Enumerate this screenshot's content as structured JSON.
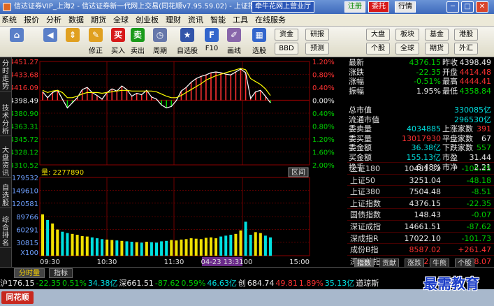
{
  "titlebar": {
    "text": "信达证券VIP_上海2 - 信达证券新一代网上交易(同花顺v7.95.59.02) - 上证指数",
    "promo": "牵牛花网上营业厅",
    "btn_register": "注册",
    "btn_delegate": "委托",
    "btn_market": "行情",
    "win_min": "─",
    "win_max": "□",
    "win_close": "✕"
  },
  "menu": [
    "系统",
    "报价",
    "分析",
    "数据",
    "期货",
    "全球",
    "创业板",
    "理财",
    "资讯",
    "智能",
    "工具",
    "在线服务"
  ],
  "toolbar": {
    "buttons": [
      {
        "label": "",
        "icon": "home-icon",
        "glyph": "⌂"
      },
      {
        "label": "",
        "icon": "back-icon",
        "glyph": "◀"
      },
      {
        "label": "",
        "icon": "updown-arrows-icon",
        "glyph": "⇕"
      },
      {
        "label": "修正",
        "icon": "modify-icon",
        "glyph": "✎"
      },
      {
        "label": "买入",
        "icon": "buy-icon",
        "glyph": "买"
      },
      {
        "label": "卖出",
        "icon": "sell-icon",
        "glyph": "卖"
      },
      {
        "label": "周期",
        "icon": "clock-icon",
        "glyph": "◷"
      },
      {
        "label": "自选股",
        "icon": "favorites-icon",
        "glyph": "★"
      },
      {
        "label": "F10",
        "icon": "f10-icon",
        "glyph": "F"
      },
      {
        "label": "画线",
        "icon": "draw-line-icon",
        "glyph": "✐"
      },
      {
        "label": "选股",
        "icon": "stock-filter-icon",
        "glyph": "▦"
      }
    ],
    "small": [
      {
        "label": "资金"
      },
      {
        "label": "研报"
      },
      {
        "label": "大盘"
      },
      {
        "label": "板块"
      },
      {
        "label": "基金"
      },
      {
        "label": "港股"
      },
      {
        "label": "BBD"
      },
      {
        "label": "预测"
      },
      {
        "label": "个股"
      },
      {
        "label": "全球"
      },
      {
        "label": "期货"
      },
      {
        "label": "外汇"
      }
    ]
  },
  "left_tabs": [
    "分时走势",
    "技术分析",
    "大盘资讯",
    "自选股",
    "综合排名"
  ],
  "chart_data": {
    "type": "line",
    "title": "",
    "price_axis": {
      "ticks": [
        "4451.27",
        "4433.68",
        "4416.09",
        "4398.49",
        "4380.90",
        "4363.31",
        "4345.72",
        "4328.12",
        "4310.52"
      ],
      "pct_ticks": [
        "1.20%",
        "0.80%",
        "0.40%",
        "0.00%",
        "0.40%",
        "0.80%",
        "1.20%",
        "1.60%",
        "2.00%"
      ],
      "ylim": [
        4310.52,
        4451.27
      ],
      "preclose": 4398.49
    },
    "volume_axis": {
      "label": "量: 2277890",
      "ticks": [
        "179532",
        "149610",
        "120581",
        "89766",
        "60291",
        "30815"
      ],
      "multiplier": "X100",
      "ylim": [
        0,
        179532
      ]
    },
    "time_axis": {
      "ticks": [
        "09:30",
        "10:30",
        "11:30",
        "14:00",
        "15:00"
      ],
      "cursor_time": "04-23 13:31"
    },
    "range_label": "区间",
    "series": [
      {
        "name": "",
        "color": "#ffffff",
        "values": [
          4410,
          4402,
          4409,
          4412,
          4400,
          4388,
          4395,
          4402,
          4413,
          4416,
          4409,
          4405,
          4400,
          4409,
          4414,
          4411,
          4418,
          4413,
          4404,
          4408,
          4406,
          4412,
          4403,
          4400,
          4392,
          4388,
          4390,
          4398,
          4411,
          4416,
          4423,
          4428,
          4431,
          4433,
          4436,
          4437,
          4436,
          4434,
          4433,
          4437,
          4441,
          4436,
          4401,
          4410,
          4412,
          4404,
          4395
        ]
      },
      {
        "name": "",
        "color": "#ffff00",
        "values": [
          4412,
          4409,
          4411,
          4412,
          4409,
          4402,
          4402,
          4404,
          4407,
          4409,
          4409,
          4409,
          4408,
          4409,
          4410,
          4411,
          4412,
          4412,
          4411,
          4411,
          4411,
          4411,
          4411,
          4410,
          4407,
          4404,
          4402,
          4402,
          4405,
          4409,
          4413,
          4417,
          4421,
          4426,
          4429,
          4432,
          4434,
          4436,
          4438,
          4440,
          4442,
          4440,
          4428,
          4424,
          4420,
          4414,
          4405
        ]
      }
    ],
    "volumes": [
      95,
      82,
      74,
      60,
      55,
      52,
      50,
      48,
      45,
      44,
      42,
      40,
      38,
      37,
      36,
      35,
      34,
      33,
      32,
      31,
      30,
      32,
      31,
      30,
      33,
      34,
      36,
      35,
      37,
      38,
      40,
      39,
      38,
      41,
      42,
      40,
      44,
      46,
      48,
      50,
      58,
      78,
      48,
      54,
      52,
      46,
      42
    ]
  },
  "right_panel": {
    "top_rows": [
      {
        "k": "最新",
        "v": "4376.15",
        "k2": "昨收",
        "v2": "4398.49",
        "vc": "grn",
        "v2c": "wht"
      },
      {
        "k": "涨跌",
        "v": "-22.35",
        "k2": "开盘",
        "v2": "4414.48",
        "vc": "grn",
        "v2c": "red"
      },
      {
        "k": "涨幅",
        "v": "-0.51%",
        "k2": "最高",
        "v2": "4444.41",
        "vc": "grn",
        "v2c": "red"
      },
      {
        "k": "振幅",
        "v": "1.95%",
        "k2": "最低",
        "v2": "4358.84",
        "vc": "wht",
        "v2c": "grn"
      },
      {
        "k": "",
        "v": "",
        "k2": "",
        "v2": "",
        "vc": "wht",
        "v2c": "wht"
      },
      {
        "k": "总市值",
        "v": "",
        "k2": "",
        "v2": "330085亿",
        "vc": "wht",
        "v2c": "cyn"
      },
      {
        "k": "流通市值",
        "v": "",
        "k2": "",
        "v2": "296530亿",
        "vc": "wht",
        "v2c": "cyn"
      },
      {
        "k": "委卖量",
        "v": "4034885",
        "k2": "上涨家数",
        "v2": "391",
        "vc": "cyn",
        "v2c": "red"
      },
      {
        "k": "委买量",
        "v": "13017930",
        "k2": "平盘家数",
        "v2": "67",
        "vc": "red",
        "v2c": "wht"
      },
      {
        "k": "委金额",
        "v": "36.38亿",
        "k2": "下跌家数",
        "v2": "557",
        "vc": "cyn",
        "v2c": "grn"
      },
      {
        "k": "买金额",
        "v": "155.13亿",
        "k2": "市盈",
        "v2": "31.44",
        "vc": "cyn",
        "v2c": "wht"
      },
      {
        "k": "换手",
        "v": "6.48%",
        "k2": "市净",
        "v2": "2.21",
        "vc": "wht",
        "v2c": "wht"
      }
    ],
    "index_rows": [
      {
        "name": "上证180",
        "price": "10481.32",
        "chg": "-105.35",
        "pc": "wht",
        "cc": "grn"
      },
      {
        "name": "上证50",
        "price": "3251.04",
        "chg": "-48.18",
        "pc": "wht",
        "cc": "grn"
      },
      {
        "name": "上证380",
        "price": "7504.48",
        "chg": "-8.51",
        "pc": "wht",
        "cc": "grn"
      },
      {
        "name": "上证指数",
        "price": "4376.15",
        "chg": "-22.35",
        "pc": "wht",
        "cc": "grn"
      },
      {
        "name": "国债指数",
        "price": "148.43",
        "chg": "-0.07",
        "pc": "wht",
        "cc": "grn"
      },
      {
        "name": "深证成指",
        "price": "14661.51",
        "chg": "-87.62",
        "pc": "wht",
        "cc": "grn"
      },
      {
        "name": "深成指R",
        "price": "17022.10",
        "chg": "-101.73",
        "pc": "wht",
        "cc": "grn"
      },
      {
        "name": "成份B指",
        "price": "8587.02",
        "chg": "+261.47",
        "pc": "red",
        "cc": "red"
      },
      {
        "name": "深证综指",
        "price": "2242.53",
        "chg": "+8.07",
        "pc": "red",
        "cc": "red"
      }
    ],
    "tabs": [
      "指数",
      "贡献",
      "涨跌",
      "牛熊",
      "个股"
    ]
  },
  "bottom_tabs": [
    "分时量",
    "指标"
  ],
  "ticker": [
    {
      "t": "沪176.15",
      "c": "wht"
    },
    {
      "t": "-22.35",
      "c": "grn"
    },
    {
      "t": "0.51%",
      "c": "grn"
    },
    {
      "t": "34.38亿",
      "c": "cyn"
    },
    {
      "t": "深661.51",
      "c": "wht"
    },
    {
      "t": "-87.62",
      "c": "grn"
    },
    {
      "t": "0.59%",
      "c": "grn"
    },
    {
      "t": "46.63亿",
      "c": "cyn"
    },
    {
      "t": "创",
      "c": "wht"
    },
    {
      "t": "684.74",
      "c": "wht"
    },
    {
      "t": "49.81",
      "c": "red"
    },
    {
      "t": "1.89%",
      "c": "red"
    },
    {
      "t": "35.13亿",
      "c": "cyn"
    },
    {
      "t": "道琼斯",
      "c": "wht"
    }
  ],
  "status_logo": "同花顺",
  "watermark": "最需教育",
  "colors": {
    "up": "#ff3232",
    "down": "#00d000",
    "price_line": "#ffffff",
    "avg_line": "#ffff00",
    "grid": "#8b0000"
  }
}
